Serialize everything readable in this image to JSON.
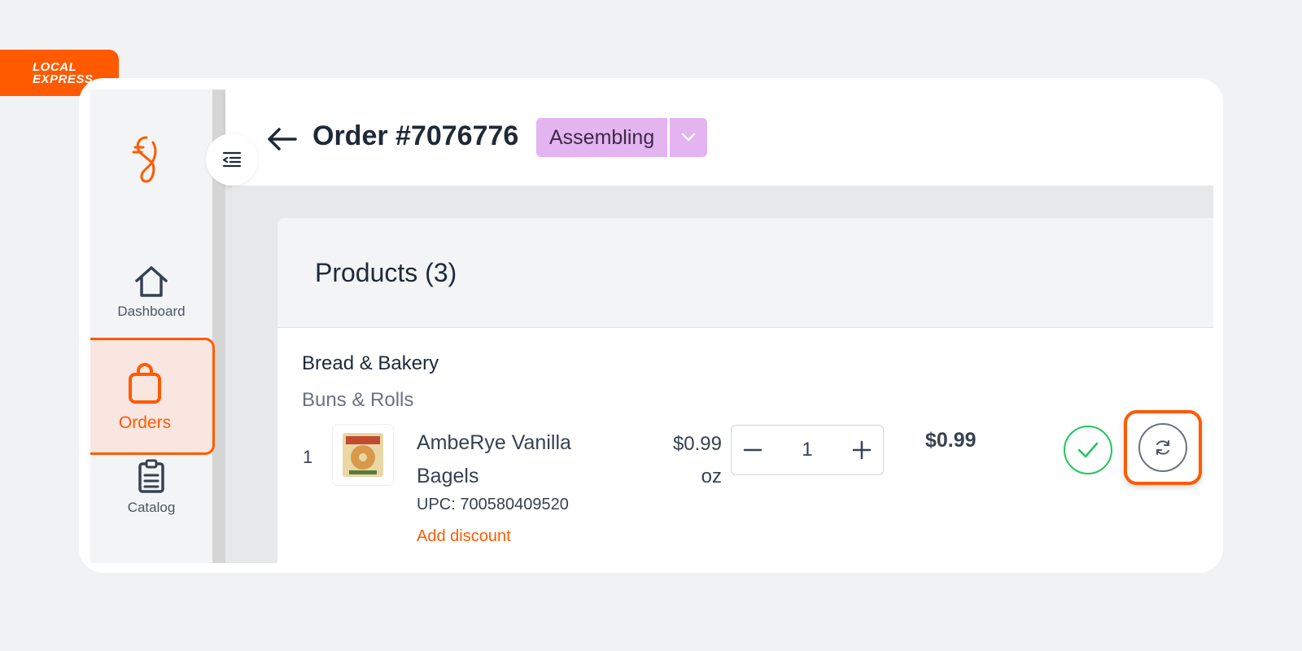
{
  "brand": {
    "line1": "LOCAL",
    "line2": "EXPRESS"
  },
  "sidebar": {
    "items": [
      {
        "label": "Dashboard",
        "icon": "home-icon"
      },
      {
        "label": "Orders",
        "icon": "shopping-bag-icon",
        "active": true
      },
      {
        "label": "Catalog",
        "icon": "clipboard-list-icon"
      }
    ]
  },
  "header": {
    "title": "Order #7076776",
    "status": "Assembling"
  },
  "products": {
    "heading": "Products (3)",
    "category": "Bread & Bakery",
    "subcategory": "Buns & Rolls",
    "rows": [
      {
        "index": "1",
        "name": "AmbeRye Vanilla Bagels",
        "upc": "UPC: 700580409520",
        "add_discount": "Add discount",
        "unit_price": "$0.99",
        "unit": "oz",
        "quantity": "1",
        "total": "$0.99"
      }
    ]
  },
  "colors": {
    "brand": "#ff5a00",
    "status_bg": "#e4b4f0",
    "check": "#22c55e"
  }
}
